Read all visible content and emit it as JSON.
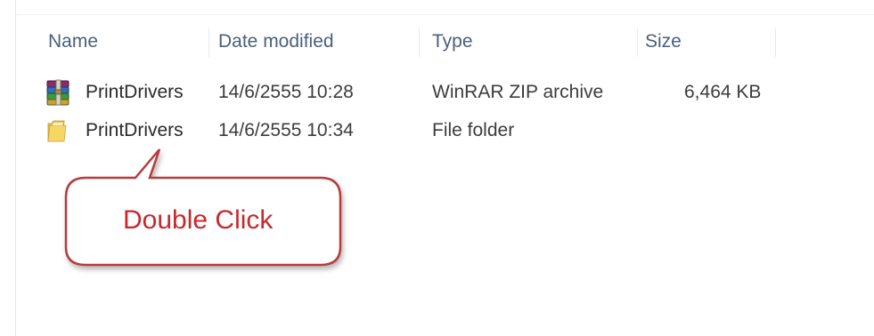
{
  "columns": {
    "name": "Name",
    "date_modified": "Date modified",
    "type": "Type",
    "size": "Size"
  },
  "rows": [
    {
      "icon": "winrar-archive-icon",
      "name": "PrintDrivers",
      "date_modified": "14/6/2555 10:28",
      "type": "WinRAR ZIP archive",
      "size": "6,464 KB"
    },
    {
      "icon": "folder-icon",
      "name": "PrintDrivers",
      "date_modified": "14/6/2555 10:34",
      "type": "File folder",
      "size": ""
    }
  ],
  "callout": {
    "text": "Double Click",
    "text_color": "#c8282b",
    "border_color": "#b83a3c"
  },
  "colors": {
    "header_text": "#4b5f7a",
    "row_text": "#2a2a2a",
    "folder_yellow": "#f1cf5b"
  }
}
